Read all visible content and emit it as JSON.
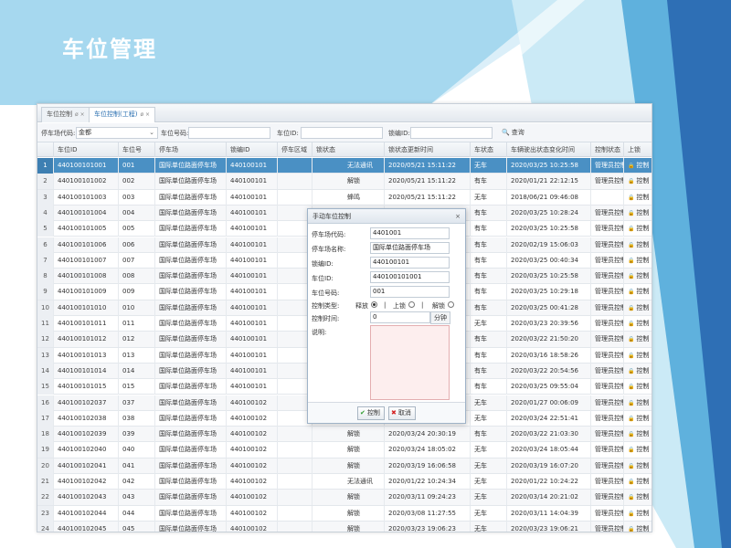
{
  "slide": {
    "title": "车位管理"
  },
  "tabs": [
    {
      "label": "车位控制",
      "close": "ø ×"
    },
    {
      "label": "车位控制(工程)",
      "close": "ø ×"
    }
  ],
  "filters": {
    "park_code_label": "停车场代码:",
    "park_code_value": "金都",
    "space_no_label": "车位号码:",
    "space_id_label": "车位ID:",
    "lock_id_label": "锁编ID:",
    "search_label": "查询"
  },
  "columns": [
    "",
    "车位ID",
    "车位号",
    "停车场",
    "锁编ID",
    "停车区域",
    "锁状态",
    "锁状态更新时间",
    "车状态",
    "车辆驶出状态变化时间",
    "控制状态",
    "上锁"
  ],
  "rows": [
    [
      "1",
      "440100101001",
      "001",
      "国际单位路面停车场",
      "440100101",
      "",
      "无法通讯",
      "2020/05/21 15:11:22",
      "无车",
      "2020/03/25 10:25:58",
      "管理员控制",
      "控制"
    ],
    [
      "2",
      "440100101002",
      "002",
      "国际单位路面停车场",
      "440100101",
      "",
      "解锁",
      "2020/05/21 15:11:22",
      "有车",
      "2020/01/21 22:12:15",
      "管理员控制",
      "控制"
    ],
    [
      "3",
      "440100101003",
      "003",
      "国际单位路面停车场",
      "440100101",
      "",
      "蜂鸣",
      "2020/05/21 15:11:22",
      "无车",
      "2018/06/21 09:46:08",
      "",
      "控制"
    ],
    [
      "4",
      "440100101004",
      "004",
      "国际单位路面停车场",
      "440100101",
      "",
      "",
      "",
      "有车",
      "2020/03/25 10:28:24",
      "管理员控制",
      "控制"
    ],
    [
      "5",
      "440100101005",
      "005",
      "国际单位路面停车场",
      "440100101",
      "",
      "",
      "",
      "有车",
      "2020/03/25 10:25:58",
      "管理员控制",
      "控制"
    ],
    [
      "6",
      "440100101006",
      "006",
      "国际单位路面停车场",
      "440100101",
      "",
      "",
      "",
      "有车",
      "2020/02/19 15:06:03",
      "管理员控制",
      "控制"
    ],
    [
      "7",
      "440100101007",
      "007",
      "国际单位路面停车场",
      "440100101",
      "",
      "",
      "",
      "有车",
      "2020/03/25 00:40:34",
      "管理员控制",
      "控制"
    ],
    [
      "8",
      "440100101008",
      "008",
      "国际单位路面停车场",
      "440100101",
      "",
      "",
      "",
      "有车",
      "2020/03/25 10:25:58",
      "管理员控制",
      "控制"
    ],
    [
      "9",
      "440100101009",
      "009",
      "国际单位路面停车场",
      "440100101",
      "",
      "",
      "",
      "有车",
      "2020/03/25 10:29:18",
      "管理员控制",
      "控制"
    ],
    [
      "10",
      "440100101010",
      "010",
      "国际单位路面停车场",
      "440100101",
      "",
      "",
      "",
      "有车",
      "2020/03/25 00:41:28",
      "管理员控制",
      "控制"
    ],
    [
      "11",
      "440100101011",
      "011",
      "国际单位路面停车场",
      "440100101",
      "",
      "",
      "",
      "无车",
      "2020/03/23 20:39:56",
      "管理员控制",
      "控制"
    ],
    [
      "12",
      "440100101012",
      "012",
      "国际单位路面停车场",
      "440100101",
      "",
      "",
      "",
      "有车",
      "2020/03/22 21:50:20",
      "管理员控制",
      "控制"
    ],
    [
      "13",
      "440100101013",
      "013",
      "国际单位路面停车场",
      "440100101",
      "",
      "",
      "",
      "有车",
      "2020/03/16 18:58:26",
      "管理员控制",
      "控制"
    ],
    [
      "14",
      "440100101014",
      "014",
      "国际单位路面停车场",
      "440100101",
      "",
      "",
      "",
      "有车",
      "2020/03/22 20:54:56",
      "管理员控制",
      "控制"
    ],
    [
      "15",
      "440100101015",
      "015",
      "国际单位路面停车场",
      "440100101",
      "",
      "",
      "",
      "有车",
      "2020/03/25 09:55:04",
      "管理员控制",
      "控制"
    ],
    [
      "16",
      "440100102037",
      "037",
      "国际单位路面停车场",
      "440100102",
      "",
      "",
      "",
      "无车",
      "2020/01/27 00:06:09",
      "管理员控制",
      "控制"
    ],
    [
      "17",
      "440100102038",
      "038",
      "国际单位路面停车场",
      "440100102",
      "",
      "",
      "",
      "无车",
      "2020/03/24 22:51:41",
      "管理员控制",
      "控制"
    ],
    [
      "18",
      "440100102039",
      "039",
      "国际单位路面停车场",
      "440100102",
      "",
      "解锁",
      "2020/03/24 20:30:19",
      "有车",
      "2020/03/22 21:03:30",
      "管理员控制",
      "控制"
    ],
    [
      "19",
      "440100102040",
      "040",
      "国际单位路面停车场",
      "440100102",
      "",
      "解锁",
      "2020/03/24 18:05:02",
      "无车",
      "2020/03/24 18:05:44",
      "管理员控制",
      "控制"
    ],
    [
      "20",
      "440100102041",
      "041",
      "国际单位路面停车场",
      "440100102",
      "",
      "解锁",
      "2020/03/19 16:06:58",
      "无车",
      "2020/03/19 16:07:20",
      "管理员控制",
      "控制"
    ],
    [
      "21",
      "440100102042",
      "042",
      "国际单位路面停车场",
      "440100102",
      "",
      "无法通讯",
      "2020/01/22 10:24:34",
      "无车",
      "2020/01/22 10:24:22",
      "管理员控制",
      "控制"
    ],
    [
      "22",
      "440100102043",
      "043",
      "国际单位路面停车场",
      "440100102",
      "",
      "解锁",
      "2020/03/11 09:24:23",
      "无车",
      "2020/03/14 20:21:02",
      "管理员控制",
      "控制"
    ],
    [
      "23",
      "440100102044",
      "044",
      "国际单位路面停车场",
      "440100102",
      "",
      "解锁",
      "2020/03/08 11:27:55",
      "无车",
      "2020/03/11 14:04:39",
      "管理员控制",
      "控制"
    ],
    [
      "24",
      "440100102045",
      "045",
      "国际单位路面停车场",
      "440100102",
      "",
      "解锁",
      "2020/03/23 19:06:23",
      "无车",
      "2020/03/23 19:06:21",
      "管理员控制",
      "控制"
    ]
  ],
  "modal": {
    "title": "手动车位控制",
    "close": "×",
    "park_code_label": "停车场代码:",
    "park_code_value": "4401001",
    "park_name_label": "停车场名称:",
    "park_name_value": "国际单位路面停车场",
    "lock_id_label": "锁编ID:",
    "lock_id_value": "440100101",
    "space_id_label": "车位ID:",
    "space_id_value": "440100101001",
    "space_no_label": "车位号码:",
    "space_no_value": "001",
    "control_type_label": "控制类型:",
    "opt_release": "释放",
    "opt_sep1": "|",
    "opt_lock": "上锁",
    "opt_sep2": "|",
    "opt_unlock": "解锁",
    "control_time_label": "控制时间:",
    "control_time_value": "0",
    "unit": "分钟",
    "remark_label": "说明:",
    "ok_label": "控制",
    "cancel_label": "取消"
  },
  "colors": {
    "accent": "#4a90c4",
    "slide_blue": "#2e6fb5",
    "light_blue": "#9ed3ec"
  }
}
